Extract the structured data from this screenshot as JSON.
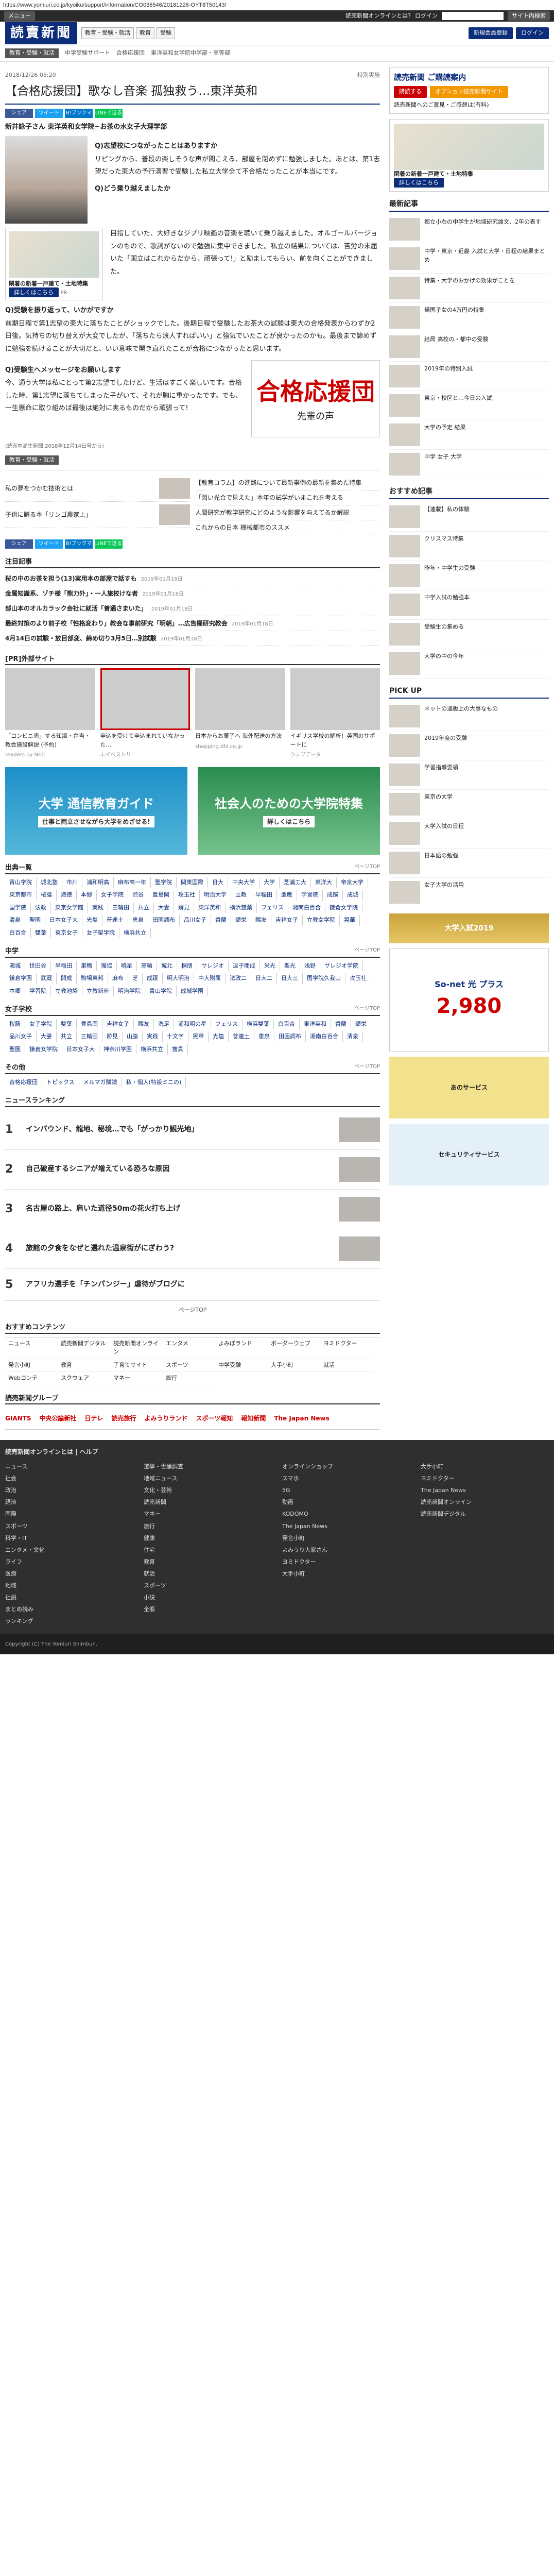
{
  "url": "https://www.yomiuri.co.jp/kyoiku/support/information/CO038546/20181226-OYT8T50143/",
  "topbar": {
    "menu": "メニュー",
    "links": [
      "読売新聞オンラインとは?",
      "ログイン"
    ],
    "search_btn": "サイト内検索"
  },
  "logo": "読賣新聞",
  "logo_nav": [
    "教育・受験・就活",
    "教育",
    "受験"
  ],
  "logo_pills": [
    "新規会員登録",
    "ログイン"
  ],
  "crumb": {
    "cat": "教育・受験・就活",
    "items": [
      "中学受験サポート",
      "合格応援団",
      "東洋英和女学院中学部・高等部"
    ]
  },
  "meta": {
    "date": "2018/12/26 05:20",
    "credit": "特別実施"
  },
  "title": "【合格応援団】歌なし音楽 孤独救う…東洋英和",
  "share": [
    "シェア",
    "ツイート",
    "B!ブックマーク",
    "LINEで送る"
  ],
  "subject_name": "新井詠子さん 東洋英和女学院~お茶の水女子大理学部",
  "qa": [
    {
      "q": "Q)志望校につながったことはありますか",
      "a": "リピングから、普段の楽しそうな声が聞こえる、部屋を閉めずに勉強しました。あとは、第1志望だった東大の予行演習で受験した私立大学全て不合格だったことが本当にです。"
    },
    {
      "q": "Q)どう乗り越えましたか",
      "a": "目指していた、大好きなジブリ映画の音楽を聴いて乗り越えました。オルゴールバージョンのもので、歌詞がないので勉強に集中できました。私立の結果については、苦労の末届いた「国立はこれからだから、頑張って!」と励ましてもらい、前を向くことができました。"
    },
    {
      "q": "Q)受験を振り返って、いかがですか",
      "a": "前期日程で第1志望の東大に落ちたことがショックでした。後期日程で受験したお茶大の試験は東大の合格発表からわずか2日後。気持ちの切り替えが大変でしたが、「落ちたら浪人すればいい」と強気でいたことが良かったのかも。最後まで諦めずに勉強を続けることが大切だと、いい意味で開き直れたことが合格につながったと思います。"
    },
    {
      "q": "Q)受験生へメッセージをお願いします",
      "a": "今、通う大学は私にとって第2志望でしたけど、生活はすごく楽しいです。合格した時、第1志望に落ちてしまった子がいて、それが胸に重かったです。でも、一生懸命に取り組めば最後は絶対に実るものだから頑張って!"
    }
  ],
  "ad_house": {
    "title": "閑着の新着一戸建て・土地特集",
    "btn": "詳しくはこちら",
    "pr": "PR"
  },
  "banner": {
    "kanji": "合格応援団",
    "sub": "先輩の声"
  },
  "published": "(読売中高生新聞 2018年12月14日号から)",
  "tags": [
    "教育・受験・就活"
  ],
  "related": [
    {
      "t": "私の夢をつかむ技術とは",
      "d": "2019年01月18日"
    },
    {
      "t": "子供に贈る本「リンゴ農家上」",
      "d": "2019年01月18日"
    }
  ],
  "related_right": [
    "【教育コラム】の進路について最新事例の最新を集めた特集",
    "「悶い光合で見えた」本年の試学がいまこれを考える",
    "人間研究が教学研究にどのような影響を与えてるか解説",
    "これからの日本 機械都市のススメ"
  ],
  "news_header": "注目記事",
  "news": [
    {
      "t": "桜の中のお茶を担う(13)実用本の部屋で話すも",
      "d": "2019年01月18日"
    },
    {
      "t": "金属知識系、ゾチ様「熊力外」・一人旅校けな者",
      "d": "2019年01月18日"
    },
    {
      "t": "部山本のオルカラック会社に就活「普通さまいた」",
      "d": "2019年01月18日"
    },
    {
      "t": "最終対策のより前子校「性格変わり」教会な事前研究「明朝」…広告欄研究教会",
      "d": "2019年01月18日"
    },
    {
      "t": "4月14日の試験・放目部変、締め切り3月5日…別試験",
      "d": "2019年01月18日"
    }
  ],
  "pr_header": "[PR]外部サイト",
  "pr": [
    {
      "t": "「コンビニ売」する知識・弁当・教会施設解説 (予約)",
      "s": "readers by NEC"
    },
    {
      "t": "申込を受けて申込まれていなかった…",
      "s": "エイベストリ"
    },
    {
      "t": "日本からお菓子へ 海外配送の方法",
      "s": "shopping.dhl.co.jp"
    },
    {
      "t": "イギリス学校の解析！英国のサポートに",
      "s": "ウエブデータ"
    }
  ],
  "bigads": [
    {
      "t": "大学 通信教育ガイド",
      "s": "仕事と両立させながら大学をめざせる!"
    },
    {
      "t": "社会人のための大学院特集",
      "s": "詳しくはこちら"
    }
  ],
  "dir_header": "出典一覧",
  "dir_more": "ページTOP",
  "dir": [
    "青山学院",
    "城北塾",
    "市川",
    "浦和明高",
    "麻布高一年",
    "聖学院",
    "関東国際",
    "日大",
    "中央大学",
    "大学",
    "芝浦工大",
    "東洋大",
    "帝京大学",
    "東京都市",
    "桜蔭",
    "淑徳",
    "本郷",
    "女子学院",
    "渋谷",
    "豊島岡",
    "攻玉社",
    "明治大学",
    "立教",
    "早稲田",
    "慶應",
    "学習院",
    "成蹊",
    "成城",
    "国学院",
    "法政",
    "東京女学館",
    "実践",
    "三輪田",
    "共立",
    "大妻",
    "跡見",
    "東洋英和",
    "横浜雙葉",
    "フェリス",
    "湘南白百合",
    "鎌倉女学院",
    "清泉",
    "聖園",
    "日本女子大",
    "光塩",
    "普連土",
    "恵泉",
    "田園調布",
    "品川女子",
    "香蘭",
    "頌栄",
    "鷗友",
    "吉祥女子",
    "立教女学院",
    "晃華",
    "白百合",
    "雙葉",
    "東京女子",
    "女子聖学院",
    "横浜共立"
  ],
  "second_header": "中学",
  "second": [
    "海城",
    "世田谷",
    "早稲田",
    "巣鴨",
    "獨協",
    "暁星",
    "高輪",
    "城北",
    "桐朋",
    "サレジオ",
    "逗子開成",
    "栄光",
    "聖光",
    "浅野",
    "サレジオ学院",
    "鎌倉学園",
    "武蔵",
    "開成",
    "駒場東邦",
    "麻布",
    "芝",
    "成蹊",
    "明大明治",
    "中大附属",
    "法政二",
    "日大二",
    "日大三",
    "国学院久我山",
    "攻玉社",
    "本郷",
    "学習院",
    "立教池袋",
    "立教新座",
    "明治学院",
    "青山学院",
    "成城学園"
  ],
  "girls_header": "女子学校",
  "girls": [
    "桜蔭",
    "女子学院",
    "雙葉",
    "豊島岡",
    "吉祥女子",
    "鷗友",
    "洗足",
    "浦和明の星",
    "フェリス",
    "横浜雙葉",
    "白百合",
    "東洋英和",
    "香蘭",
    "頌栄",
    "品川女子",
    "大妻",
    "共立",
    "三輪田",
    "跡見",
    "山脇",
    "実践",
    "十文字",
    "晃華",
    "光塩",
    "普連土",
    "恵泉",
    "田園調布",
    "湘南白百合",
    "清泉",
    "聖園",
    "鎌倉女学院",
    "日本女子大",
    "神奈川学園",
    "横浜共立",
    "捜真"
  ],
  "other_header": "その他",
  "other": [
    "合格応援団",
    "トピックス",
    "メルマガ購読",
    "私・個人(特設ミニの)"
  ],
  "rank_header": "ニュースランキング",
  "ranking": [
    {
      "n": "1",
      "t": "インバウンド、龍地、秘境…でも「がっかり観光地」"
    },
    {
      "n": "2",
      "t": "自己破産するシニアが増えている恐ろな原因"
    },
    {
      "n": "3",
      "t": "名古屋の路上、肩いた道径50mの花火打ち上げ"
    },
    {
      "n": "4",
      "t": "旅館の夕食をなぜと選れた温泉街がにぎわう?"
    },
    {
      "n": "5",
      "t": "アフリカ選手を「チンパンジー」虐待がブログに"
    }
  ],
  "ranking_more": "ページTOP",
  "contents_header": "おすすめコンテンツ",
  "contents": [
    "ニュース",
    "読売新聞デジタル",
    "読売新聞オンライン",
    "エンタメ",
    "よみぽランド",
    "ボーダーウェブ",
    "ヨミドクター",
    "発言小町",
    "教育",
    "子育てサイト",
    "スポーツ",
    "中学受験",
    "大手小町",
    "就活",
    "Webコンテ",
    "スクウェア",
    "マネー",
    "旅行"
  ],
  "group_header": "読売新聞グループ",
  "group": [
    "GIANTS",
    "中央公論新社",
    "日テレ",
    "読売旅行",
    "よみうりランド",
    "スポーツ報知",
    "報知新聞",
    "The Japan News"
  ],
  "side": {
    "subscribe": "読売新聞 ご購読案内",
    "sub_btns": [
      "購読する",
      "オプション読売新聞サイト"
    ],
    "sub_note": "読売新聞へのご意見・ご感想は(有料)",
    "house": "閑着の新着一戸建て・土地特集",
    "house_btn": "詳しくはこちら",
    "latest_h": "最新記事",
    "latest": [
      "都立小右の中学生が地域研究論文、2年の表す",
      "中学・東京・近畿 入試と大学・日程の結果まとめ",
      "特集・大学のおかげの効果がことを",
      "帰国子女の4万円の特集",
      "結局 高校の・都中の受験",
      "2019年の特別入試",
      "東京・校区と…今日の入試",
      "大学の予定 結果",
      "中学 女子 大学"
    ],
    "pickup_h": "おすすめ記事",
    "pickup": [
      "【連載】私の体験",
      "クリスマス特集",
      "昨年・中学生の受験",
      "中学入試の勉強本",
      "受験生の集める",
      "大学の中の今年"
    ],
    "pickup2_h": "PICK UP",
    "pickup2": [
      "ネットの通販上の大事なもの",
      "2019年度の受験",
      "学習指導要領",
      "東京の大学",
      "大学入試の日程",
      "日本語の勉強",
      "女子大学の活用"
    ],
    "ads": [
      "大学入試2019",
      "So-net 光 プラス",
      "あのサービス",
      "セキュリティサービス"
    ],
    "ad_price": "2,980"
  },
  "footer": {
    "title": "読売新聞オンラインとは | ヘルプ",
    "cols": [
      [
        "ニュース",
        "社会",
        "政治",
        "経済",
        "国際",
        "スポーツ",
        "科学・IT",
        "エンタメ・文化",
        "ライフ",
        "医療",
        "地域",
        "社説",
        "まとめ読み",
        "ランキング"
      ],
      [
        "選挙・世論調査",
        "地域ニュース",
        "文化・芸術",
        "読売新聞",
        "マネー",
        "旅行",
        "健康",
        "住宅",
        "教育",
        "就活",
        "スポーツ",
        "小説",
        "全般"
      ],
      [
        "オンラインショップ",
        "スマホ",
        "5G",
        "動画",
        "KODOMO",
        "The Japan News",
        "発言小町",
        "よみうり大家さん",
        "ヨミドクター",
        "大手小町"
      ],
      [
        "大手小町",
        "ヨミドクター",
        "The Japan News",
        "読売新聞オンライン",
        "読売新聞デジタル"
      ]
    ],
    "copyright": "Copyright (C) The Yomiuri Shimbun."
  }
}
